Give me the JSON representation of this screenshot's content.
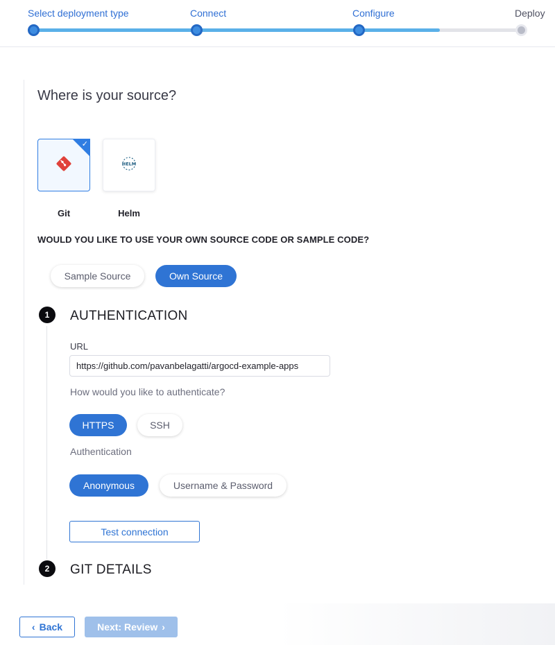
{
  "stepper": {
    "steps": [
      {
        "label": "Select deployment type",
        "state": "done"
      },
      {
        "label": "Connect",
        "state": "done"
      },
      {
        "label": "Configure",
        "state": "current"
      },
      {
        "label": "Deploy",
        "state": "pending"
      }
    ],
    "progress": 0.83
  },
  "source": {
    "title": "Where is your source?",
    "options": [
      {
        "label": "Git",
        "icon": "git-icon",
        "selected": true
      },
      {
        "label": "Helm",
        "icon": "helm-icon",
        "selected": false
      }
    ],
    "helm_logo_text": "HELM"
  },
  "code_choice": {
    "question": "WOULD YOU LIKE TO USE YOUR OWN SOURCE CODE OR SAMPLE CODE?",
    "sample_label": "Sample Source",
    "own_label": "Own Source",
    "selected": "Own Source"
  },
  "authentication": {
    "number": "1",
    "title": "AUTHENTICATION",
    "url_label": "URL",
    "url_value": "https://github.com/pavanbelagatti/argocd-example-apps",
    "method_question": "How would you like to authenticate?",
    "methods": [
      "HTTPS",
      "SSH"
    ],
    "method_selected": "HTTPS",
    "auth_label": "Authentication",
    "auth_types": [
      "Anonymous",
      "Username & Password"
    ],
    "auth_selected": "Anonymous",
    "test_button": "Test connection"
  },
  "git_details": {
    "number": "2",
    "title": "GIT DETAILS"
  },
  "footer": {
    "back_label": "Back",
    "next_label": "Next: Review"
  },
  "colors": {
    "accent": "#2f74d4",
    "progress": "#5ab0e8",
    "disabled": "#9fc0ea"
  }
}
